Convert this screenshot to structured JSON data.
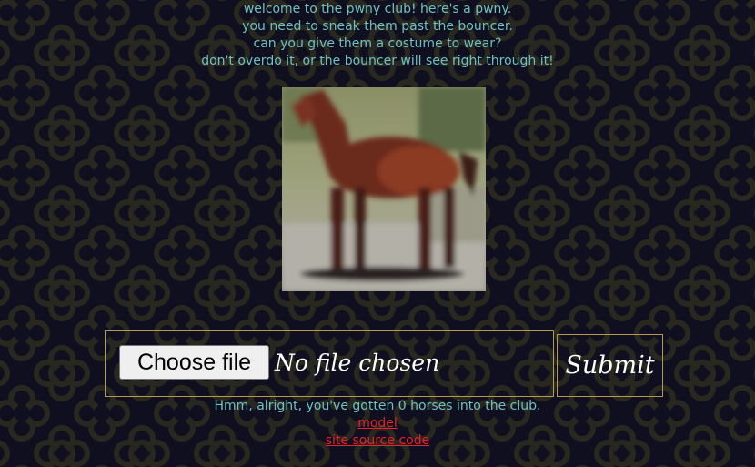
{
  "intro": {
    "lines": [
      "welcome to the pwny club! here's a pwny.",
      "you need to sneak them past the bouncer.",
      "can you give them a costume to wear?",
      "don't overdo it, or the bouncer will see right through it!"
    ]
  },
  "pwny_image": {
    "icon": "horse-photo"
  },
  "upload": {
    "choose_label": "Choose file",
    "file_status": "No file chosen",
    "submit_label": "Submit"
  },
  "status": {
    "message": "Hmm, alright, you've gotten 0 horses into the club."
  },
  "links": {
    "model": "model",
    "source": "site source code"
  },
  "colors": {
    "background": "#0f0f1f",
    "pattern": "#2b2a22",
    "text": "#6fc2c2",
    "border": "#b59a4c",
    "link": "#e8212b"
  }
}
